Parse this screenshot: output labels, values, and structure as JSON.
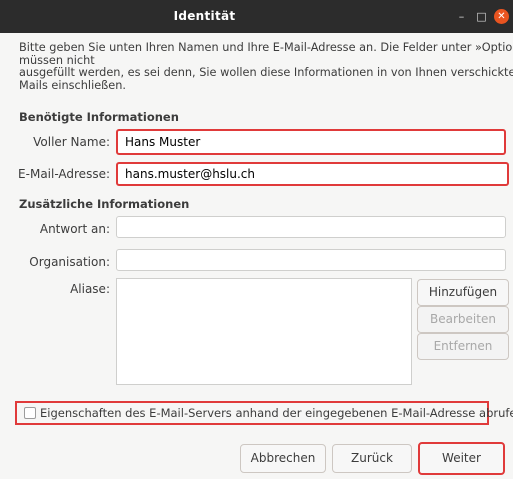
{
  "window": {
    "title": "Identität",
    "minimize": "–",
    "maximize": "□",
    "close": "✕"
  },
  "intro": {
    "line1": "Bitte geben Sie unten Ihren Namen und Ihre E-Mail-Adresse an. Die Felder unter »Optional«",
    "line2": "müssen nicht",
    "line3": "ausgefüllt werden, es sei denn, Sie wollen diese Informationen in von Ihnen verschickten E-",
    "line4": "Mails einschließen."
  },
  "required": {
    "heading": "Benötigte Informationen",
    "name_label": "Voller Name:",
    "name_value": "Hans Muster",
    "email_label": "E-Mail-Adresse:",
    "email_value": "hans.muster@hslu.ch"
  },
  "optional": {
    "heading": "Zusätzliche Informationen",
    "reply_label": "Antwort an:",
    "reply_value": "",
    "org_label": "Organisation:",
    "org_value": "",
    "aliases_label": "Aliase:",
    "add_label": "Hinzufügen",
    "edit_label": "Bearbeiten",
    "remove_label": "Entfernen"
  },
  "autoconfig": {
    "checked": false,
    "label": "Eigenschaften des E-Mail-Servers anhand der eingegebenen E-Mail-Adresse abrufen"
  },
  "buttons": {
    "cancel": "Abbrechen",
    "back": "Zurück",
    "next": "Weiter"
  },
  "colors": {
    "titlebar": "#2c2c2c",
    "close_button": "#e95420",
    "highlight": "#e03a3a"
  }
}
